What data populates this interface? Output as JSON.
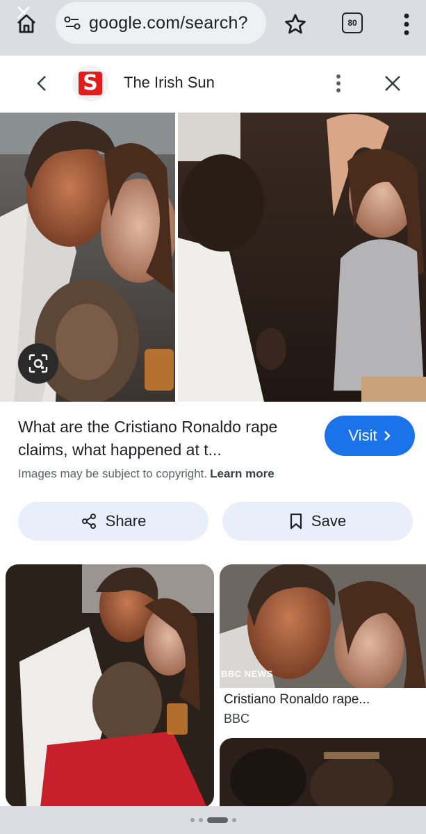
{
  "browser": {
    "url": "google.com/search?",
    "tab_count": "80"
  },
  "panel": {
    "source_name": "The Irish Sun",
    "source_logo_letter": "S"
  },
  "result": {
    "title": "What are the Cristiano Ronaldo rape claims, what happened at t...",
    "visit_label": "Visit",
    "copyright_text": "Images may be subject to copyright.",
    "learn_more": "Learn more",
    "share_label": "Share",
    "save_label": "Save"
  },
  "related": {
    "bbc_logo": "BBC NEWS",
    "bbc_caption": "Cristiano Ronaldo rape...",
    "bbc_source": "BBC"
  },
  "colors": {
    "accent": "#1a73e8",
    "sun_red": "#e21b1b",
    "chip_bg": "#e8eefa"
  }
}
